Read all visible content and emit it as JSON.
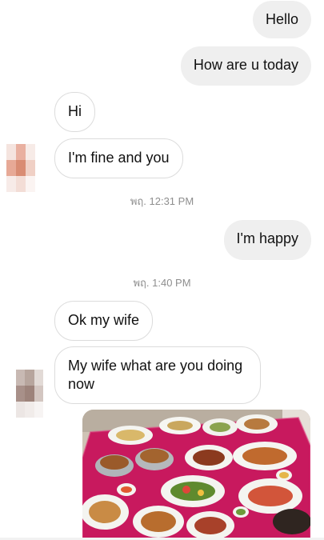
{
  "messages": {
    "hello": "Hello",
    "how_are_u": "How are u today",
    "hi": "Hi",
    "fine": "I'm fine and you",
    "time1": "พฤ. 12:31 PM",
    "happy": "I'm happy",
    "time2": "พฤ. 1:40 PM",
    "ok_wife": "Ok my wife",
    "wife_doing": "My wife what are you doing now"
  },
  "avatars": {
    "contact_1": {
      "icon": "blurred-avatar"
    },
    "contact_2": {
      "icon": "blurred-avatar"
    }
  },
  "attachment": {
    "icon": "food-photo"
  },
  "colors": {
    "outgoing_bubble": "#efefef",
    "incoming_border": "#dcdcdc",
    "timestamp": "#8e8e8e",
    "tablecloth": "#c8195e"
  }
}
